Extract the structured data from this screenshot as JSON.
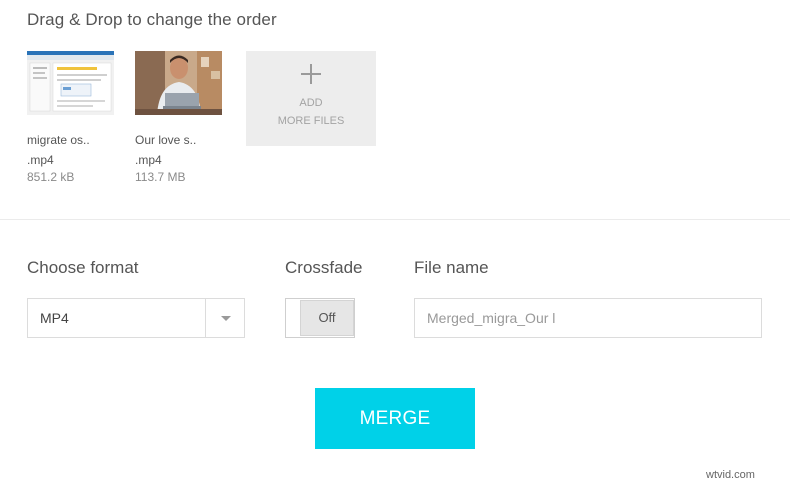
{
  "instructions": "Drag & Drop to change the order",
  "files": [
    {
      "name": "migrate os..",
      "ext": ".mp4",
      "size": "851.2 kB"
    },
    {
      "name": "Our love s..",
      "ext": ".mp4",
      "size": "113.7 MB"
    }
  ],
  "add_tile": {
    "line1": "ADD",
    "line2": "MORE FILES"
  },
  "format": {
    "label": "Choose format",
    "value": "MP4"
  },
  "crossfade": {
    "label": "Crossfade",
    "state": "Off"
  },
  "filename": {
    "label": "File name",
    "value": "Merged_migra_Our l"
  },
  "merge_label": "MERGE",
  "watermark": "wtvid.com",
  "colors": {
    "accent": "#00d1e8",
    "tile_bg": "#ededed"
  }
}
